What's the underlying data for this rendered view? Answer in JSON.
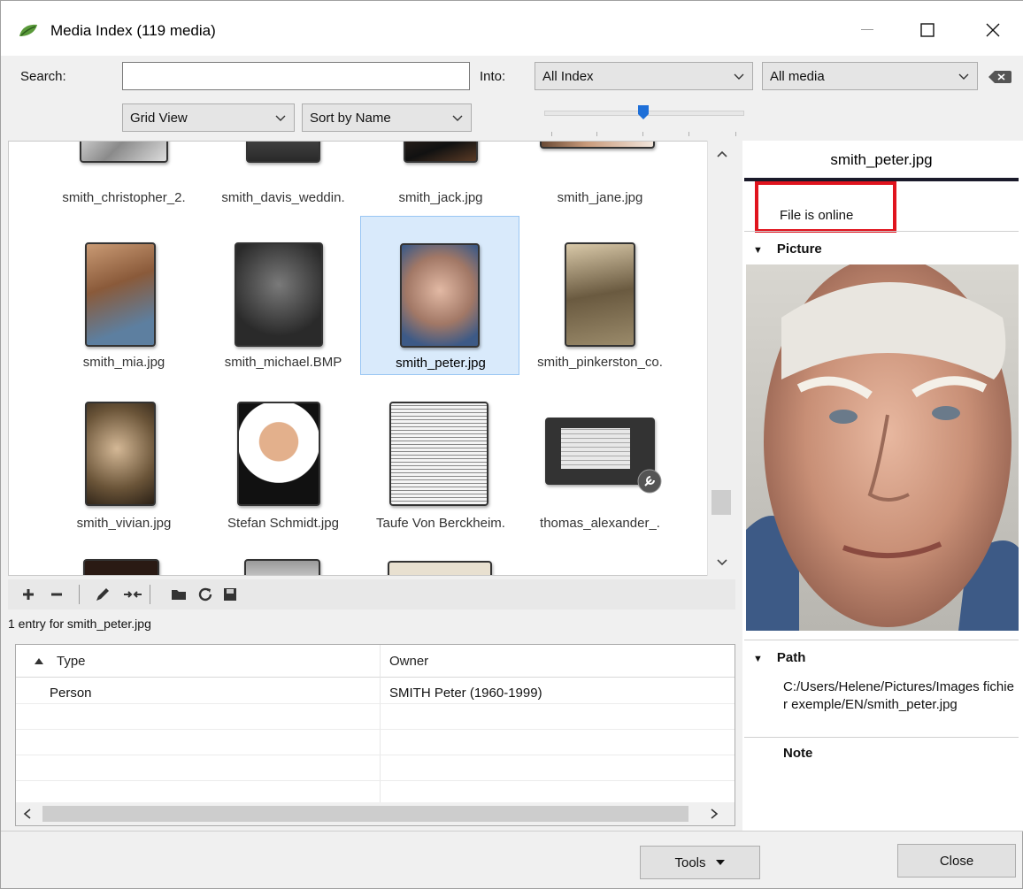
{
  "window": {
    "title": "Media Index (119 media)",
    "min_icon": "minimize-icon",
    "max_icon": "maximize-icon",
    "close_icon": "close-icon"
  },
  "toolbar": {
    "search_label": "Search:",
    "search_value": "",
    "into_label": "Into:",
    "into_value": "All Index",
    "media_filter": "All media",
    "view_mode": "Grid View",
    "sort_mode": "Sort by Name"
  },
  "grid": {
    "items": [
      {
        "label": "smith_christopher_2."
      },
      {
        "label": "smith_davis_weddin."
      },
      {
        "label": "smith_jack.jpg"
      },
      {
        "label": "smith_jane.jpg"
      },
      {
        "label": "smith_mia.jpg"
      },
      {
        "label": "smith_michael.BMP"
      },
      {
        "label": "smith_peter.jpg",
        "selected": true
      },
      {
        "label": "smith_pinkerston_co."
      },
      {
        "label": "smith_vivian.jpg"
      },
      {
        "label": "Stefan Schmidt.jpg"
      },
      {
        "label": "Taufe Von Berckheim."
      },
      {
        "label": "thomas_alexander_."
      }
    ]
  },
  "actions": {
    "entry_text": "1 entry for smith_peter.jpg"
  },
  "table": {
    "col_type": "Type",
    "col_owner": "Owner",
    "rows": [
      {
        "type": "Person",
        "owner": "SMITH Peter (1960-1999)"
      }
    ]
  },
  "details": {
    "filename": "smith_peter.jpg",
    "status": "File is online",
    "picture_title": "Picture",
    "path_title": "Path",
    "path_value": "C:/Users/Helene/Pictures/Images fichier exemple/EN/smith_peter.jpg",
    "note_title": "Note"
  },
  "footer": {
    "tools_label": "Tools",
    "close_label": "Close"
  },
  "colors": {
    "selection": "#d9eafb",
    "highlight_box": "#e0141e"
  }
}
